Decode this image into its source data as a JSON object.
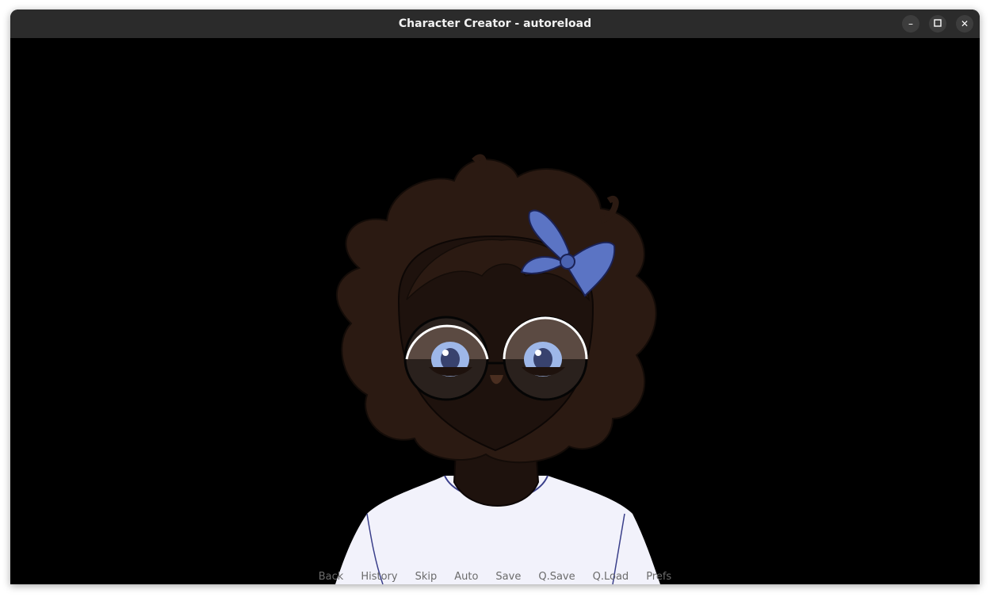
{
  "window": {
    "title": "Character Creator - autoreload",
    "controls": {
      "minimize": "–",
      "maximize": "☐",
      "close": "✕"
    }
  },
  "scene": {
    "background_color": "#000000",
    "character": {
      "hair_color": "#2b1a12",
      "skin_color": "#1e120d",
      "bow_color": "#5b74c4",
      "shirt_color": "#f2f2fb",
      "eye_color": "#7f9ad6"
    }
  },
  "quick_menu": {
    "items": [
      "Back",
      "History",
      "Skip",
      "Auto",
      "Save",
      "Q.Save",
      "Q.Load",
      "Prefs"
    ]
  }
}
